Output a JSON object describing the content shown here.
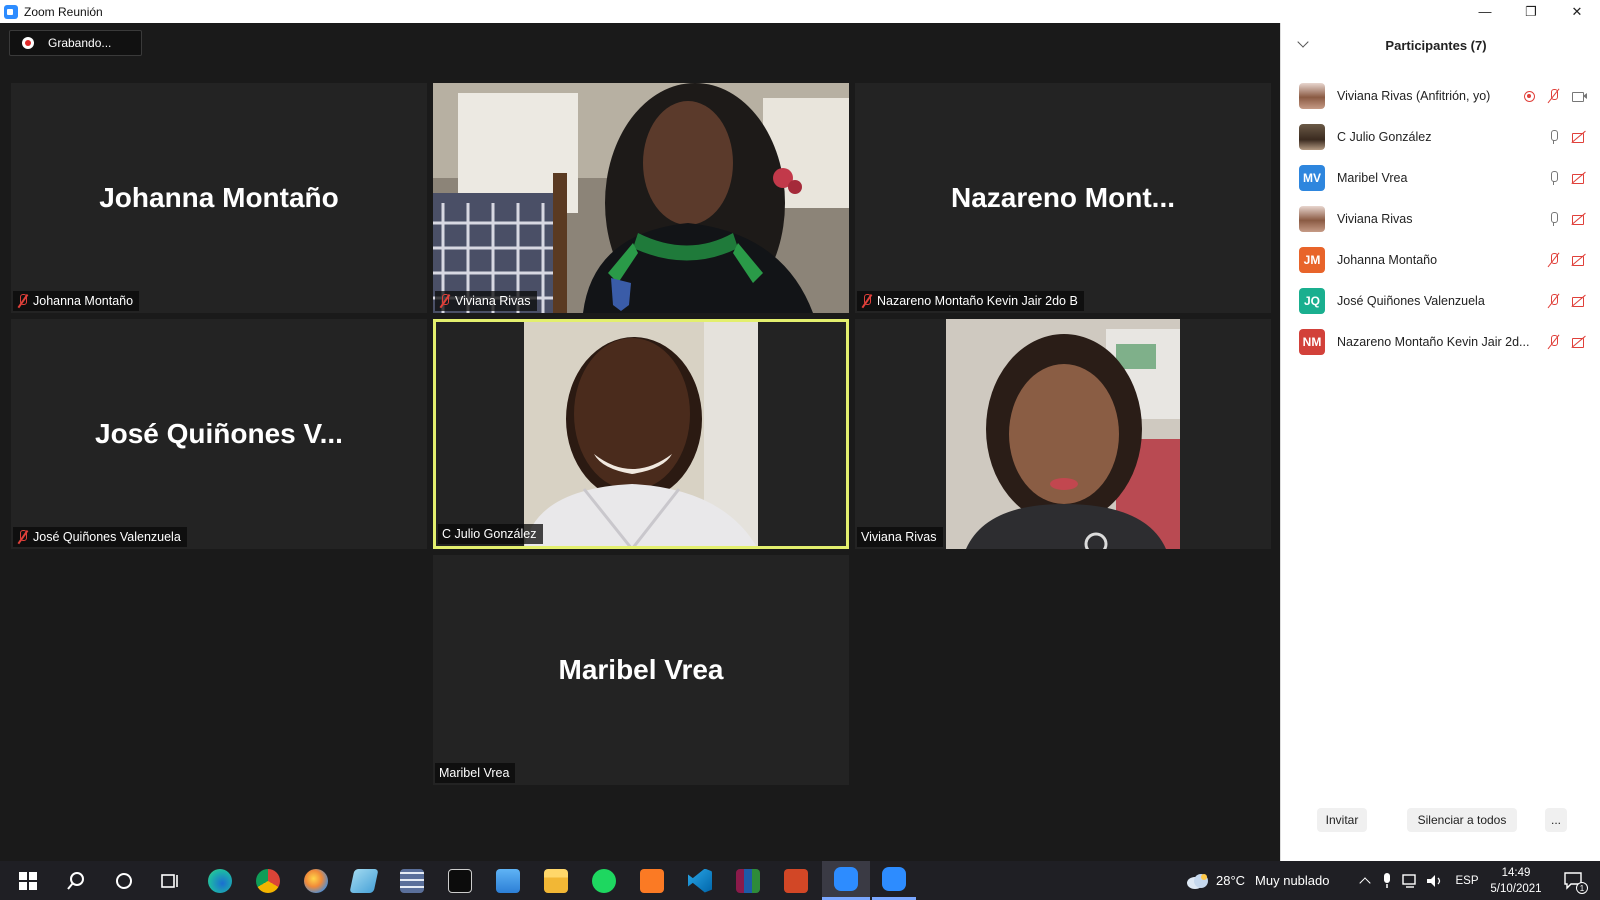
{
  "window": {
    "title": "Zoom Reunión",
    "minimize": "—",
    "maximize": "❐",
    "close": "✕"
  },
  "recording": {
    "label": "Grabando..."
  },
  "tiles": {
    "johanna": {
      "big_name": "Johanna Montaño",
      "tag": "Johanna Montaño"
    },
    "viviana_video": {
      "tag": "Viviana Rivas"
    },
    "nazareno": {
      "big_name": "Nazareno  Mont...",
      "tag": "Nazareno Montaño Kevin Jair 2do B"
    },
    "jose": {
      "big_name": "José  Quiñones  V...",
      "tag": "José Quiñones Valenzuela"
    },
    "julio": {
      "tag": "C Julio González"
    },
    "viviana2": {
      "tag": "Viviana Rivas"
    },
    "maribel": {
      "big_name": "Maribel Vrea",
      "tag": "Maribel Vrea"
    }
  },
  "panel": {
    "title": "Participantes (7)",
    "participants": [
      {
        "name": "Viviana Rivas (Anfitrión, yo)",
        "initials": "",
        "avatar": "photo",
        "avatar_color": "",
        "icons": [
          "rec",
          "mic-muted",
          "cam-on"
        ]
      },
      {
        "name": "C Julio González",
        "initials": "",
        "avatar": "photo",
        "avatar_color": "",
        "icons": [
          "mic-on",
          "cam-off"
        ]
      },
      {
        "name": "Maribel Vrea",
        "initials": "MV",
        "avatar": "initials",
        "avatar_color": "#2e86de",
        "icons": [
          "mic-on",
          "cam-off"
        ]
      },
      {
        "name": "Viviana Rivas",
        "initials": "",
        "avatar": "photo",
        "avatar_color": "",
        "icons": [
          "mic-on",
          "cam-off"
        ]
      },
      {
        "name": "Johanna Montaño",
        "initials": "JM",
        "avatar": "initials",
        "avatar_color": "#e8642a",
        "icons": [
          "mic-muted",
          "cam-off"
        ]
      },
      {
        "name": "José Quiñones Valenzuela",
        "initials": "JQ",
        "avatar": "initials",
        "avatar_color": "#1aaf8f",
        "icons": [
          "mic-muted",
          "cam-off"
        ]
      },
      {
        "name": "Nazareno Montaño Kevin Jair 2d...",
        "initials": "NM",
        "avatar": "initials",
        "avatar_color": "#d2413a",
        "icons": [
          "mic-muted",
          "cam-off"
        ]
      }
    ],
    "invite_label": "Invitar",
    "mute_all_label": "Silenciar a todos",
    "more_label": "..."
  },
  "taskbar": {
    "weather": "28°C",
    "weather_desc": "Muy nublado",
    "language": "ESP",
    "time": "14:49",
    "date": "5/10/2021",
    "notifications": "1"
  },
  "colors": {
    "active_speaker": "#e3ef6e",
    "muted": "#e0403a",
    "zoom_blue": "#2d8cff"
  }
}
